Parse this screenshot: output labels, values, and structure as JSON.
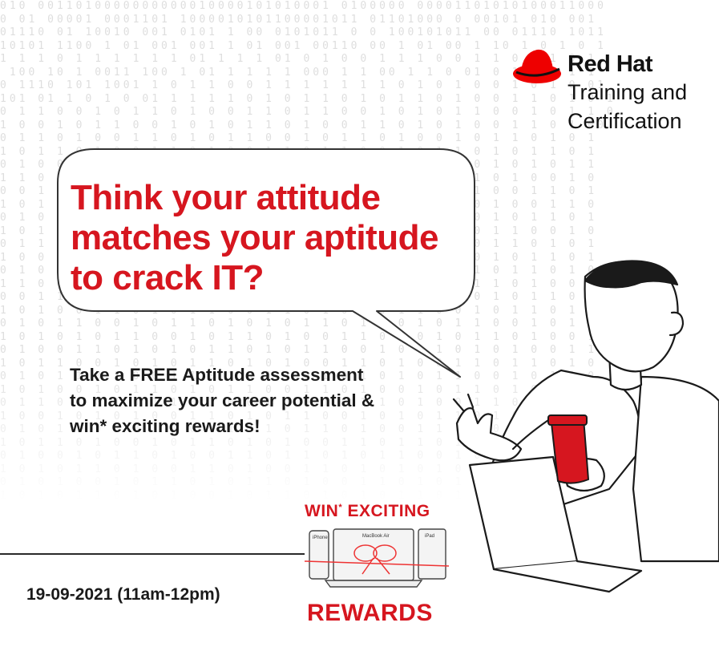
{
  "background": {
    "binary_rows": [
      "010 0011010000000000010000101010001 0100000 00001101010100011000",
      "0 01 00001 0001101 1000010101100001011 01101000 0 00101 010 001",
      "01110 01 10010 001 0101 1 00 0101011 0 0 100101011 00 01110 1011",
      "10101 1100 1 01 001 001 1 01 001 00110 00 1 01 00 1 10 1 0 1 0 1",
      "1 1 1 0 1 1 1 1 1 1 01 1 1 1 01 0 1 0 0 1 1 1 0 0 1 1 0 1 1 0 1",
      " 100 10 1 0011 100 1 01 1 1 1 1 000 1 1 00 1 1 0 01 0 1 0 0 1 1",
      "0 1110 101 1001 1 0 1 1 0 0 1 1 1 1 1 1 1 0 1 0 1 0 0 1 0 1 0 01",
      "101 01 1 0 1 0 01 1 1 1 1 0 1 0 1 1 0 1 0 1 1 0 1 0 0 1 1 0 1 0 1",
      "0 1 1 0 0 1 0 1 1 0 1 0 0 1 1 0 1 1 0 0 1 0 1 0 1 1 0 0 1 0 1 1 0",
      "1 0 0 1 0 1 1 0 0 1 0 1 0 1 1 0 1 0 0 1 1 0 1 0 1 0 0 1 1 0 1 00",
      "0 1 1 0 1 0 0 1 1 0 1 0 1 1 0 0 1 0 1 1 0 1 0 0 1 0 1 1 0 1 0 1",
      "1 0 1 1 0 1 0 0 1 1 0 1 0 0 1 1 0 1 1 0 0 1 0 1 1 0 1 0 1 1 0 1",
      "0 1 0 0 1 1 0 1 0 1 1 0 1 0 0 1 1 0 1 0 1 0 1 1 0 0 1 0 1 0 1 1",
      "1 1 0 1 0 0 1 1 0 1 0 1 0 1 1 0 1 0 1 1 0 1 0 0 1 1 0 1 0 0 1 0",
      "0 0 1 1 0 1 0 1 1 0 0 1 1 0 1 0 0 1 1 0 1 0 1 1 0 1 0 0 1 1 0 1",
      "1 0 1 0 1 1 0 0 1 0 1 1 0 1 0 1 1 0 0 1 0 1 1 0 1 0 1 0 0 1 1 0",
      "0 1 0 1 0 0 1 1 0 1 1 0 1 0 0 1 0 1 1 0 1 1 0 1 0 0 1 0 1 1 0 1",
      "1 0 1 0 1 1 0 1 0 0 1 1 0 1 0 1 0 0 1 1 0 1 0 1 1 0 1 1 0 0 1 0",
      "0 1 1 0 0 1 0 1 1 0 1 0 0 1 1 0 1 0 1 1 0 0 1 0 1 0 1 1 0 1 0 1",
      "1 0 0 1 1 0 1 0 0 1 0 1 1 0 1 0 1 1 0 0 1 1 0 1 0 0 1 0 1 1 0 1",
      "0 1 0 1 0 1 1 0 1 1 0 0 1 0 1 1 0 1 0 0 1 0 1 1 0 1 0 1 1 0 1 0",
      "1 1 0 0 1 0 1 0 1 0 1 1 0 1 0 0 1 1 0 1 1 0 1 0 0 1 1 0 1 0 0 1",
      "0 0 1 1 0 1 0 1 0 1 0 0 1 1 0 1 0 1 1 0 0 1 0 1 1 0 1 0 1 1 0 1",
      "1 0 1 0 0 1 1 0 1 0 1 1 0 0 1 1 0 1 0 1 0 1 1 0 0 1 0 1 1 0 1 0",
      "0 1 0 1 1 0 0 1 0 1 1 0 1 0 1 0 1 1 0 1 0 0 1 0 1 1 0 0 1 0 1 1",
      "1 0 1 0 1 0 1 1 0 0 1 0 1 1 0 1 0 0 1 1 0 1 0 1 0 1 1 0 1 0 0 1",
      "0 1 0 0 1 1 0 1 0 1 0 1 1 0 1 0 1 1 0 0 1 0 1 1 0 1 0 1 0 0 1 1",
      "1 0 1 1 0 0 1 0 1 0 1 1 0 1 0 1 0 0 1 1 0 1 0 0 1 1 0 1 1 0 1 0",
      "0 1 0 1 1 0 1 0 0 1 1 0 1 0 1 1 0 1 0 1 0 1 0 1 1 0 0 1 0 1 1 0",
      "1 0 1 0 0 1 0 1 1 0 1 0 1 1 0 0 1 1 0 1 0 0 1 0 1 1 0 1 0 1 0 1",
      "0 1 1 0 1 0 1 0 1 1 0 1 0 0 1 1 0 1 0 1 1 0 1 0 0 1 1 0 1 0 1 0",
      "1 0 0 1 0 1 0 1 0 0 1 1 0 1 0 1 1 0 0 1 0 1 0 1 1 0 1 0 0 1 1 0",
      "0 1 0 1 1 0 1 0 1 1 0 0 1 0 1 0 1 1 0 1 0 0 1 1 0 1 0 1 1 0 0 1",
      "1 0 1 1 0 1 0 0 1 0 1 1 0 1 0 1 0 0 1 1 0 1 1 0 1 0 0 1 0 1 1 0",
      "0 1 0 0 1 0 1 1 0 1 0 0 1 1 0 1 1 0 1 0 1 1 0 0 1 0 1 1 0 1 0 1",
      "1 0 1 0 1 1 0 1 0 0 1 1 0 1 0 0 1 1 0 1 0 1 0 1 0 1 1 0 1 0 1 0",
      "0 1 0 1 0 0 1 0 1 1 0 1 0 1 1 0 1 0 0 1 1 0 1 0 1 0 0 1 1 0 1 1",
      "1 0 1 0 1 1 0 1 0 1 0 0 1 0 1 1 0 1 0 1 0 1 1 0 1 1 0 0 1 0 1 0",
      "0 1 0 1 0 1 1 0 1 0 1 1 0 1 0 0 1 0 1 1 0 1 0 1 0 1 0 1 1 0 1 0"
    ]
  },
  "brand": {
    "name": "Red Hat",
    "line1": "Training and",
    "line2": "Certification",
    "colors": {
      "red": "#ee0000",
      "dark": "#111111"
    }
  },
  "headline": {
    "line1": "Think your attitude",
    "line2": "matches your aptitude",
    "line3": "to crack IT?"
  },
  "subtext": {
    "line1": "Take a FREE Aptitude assessment",
    "line2": "to maximize your career potential &",
    "line3": "win* exciting rewards!"
  },
  "event": {
    "date": "19-09-2021 (11am-12pm)"
  },
  "rewards": {
    "top": "WIN",
    "sup": "*",
    "top_rest": " EXCITING",
    "bottom": "REWARDS",
    "devices": {
      "phone": "iPhone",
      "laptop": "MacBook Air",
      "tablet": "iPad"
    }
  },
  "accent_color": "#d6161f"
}
